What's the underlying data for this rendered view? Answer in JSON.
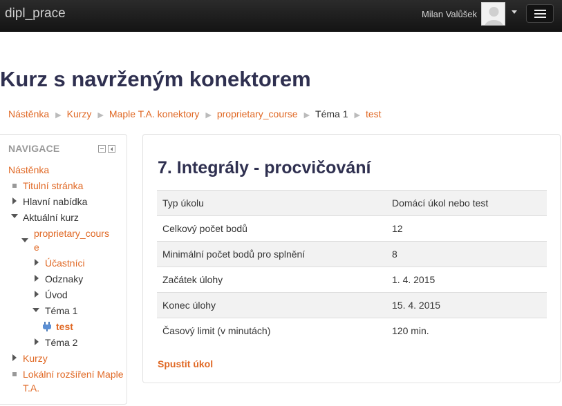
{
  "navbar": {
    "brand": "dipl_prace",
    "user_name": "Milan Valůšek"
  },
  "page": {
    "title": "Kurz s navrženým konektorem"
  },
  "breadcrumb": [
    {
      "label": "Nástěnka"
    },
    {
      "label": "Kurzy"
    },
    {
      "label": "Maple T.A. konektory"
    },
    {
      "label": "proprietary_course"
    },
    {
      "label": "Téma 1"
    },
    {
      "label": "test"
    }
  ],
  "navigation": {
    "header": "NAVIGACE",
    "items": {
      "dashboard": "Nástěnka",
      "site_home": "Titulní stránka",
      "main_menu": "Hlavní nabídka",
      "current_course": "Aktuální kurz",
      "course_line1": "proprietary_cours",
      "course_line2": "e",
      "participants": "Účastníci",
      "badges": "Odznaky",
      "intro": "Úvod",
      "topic1": "Téma 1",
      "test": "test",
      "topic2": "Téma 2",
      "courses": "Kurzy",
      "local_line1": "Lokální rozšíření Maple",
      "local_line2": "T.A."
    }
  },
  "main": {
    "title": "7. Integrály - procvičování",
    "rows": [
      {
        "label": "Typ úkolu",
        "value": "Domácí úkol nebo test"
      },
      {
        "label": "Celkový počet bodů",
        "value": "12"
      },
      {
        "label": "Minimální počet bodů pro splnění",
        "value": "8"
      },
      {
        "label": "Začátek úlohy",
        "value": "1. 4. 2015"
      },
      {
        "label": "Konec úlohy",
        "value": "15. 4. 2015"
      },
      {
        "label": "Časový limit (v minutách)",
        "value": "120 min."
      }
    ],
    "start_link": "Spustit úkol"
  },
  "colors": {
    "link": "#e06824",
    "heading": "#2f3050",
    "navbar": "#1a1a1a"
  }
}
